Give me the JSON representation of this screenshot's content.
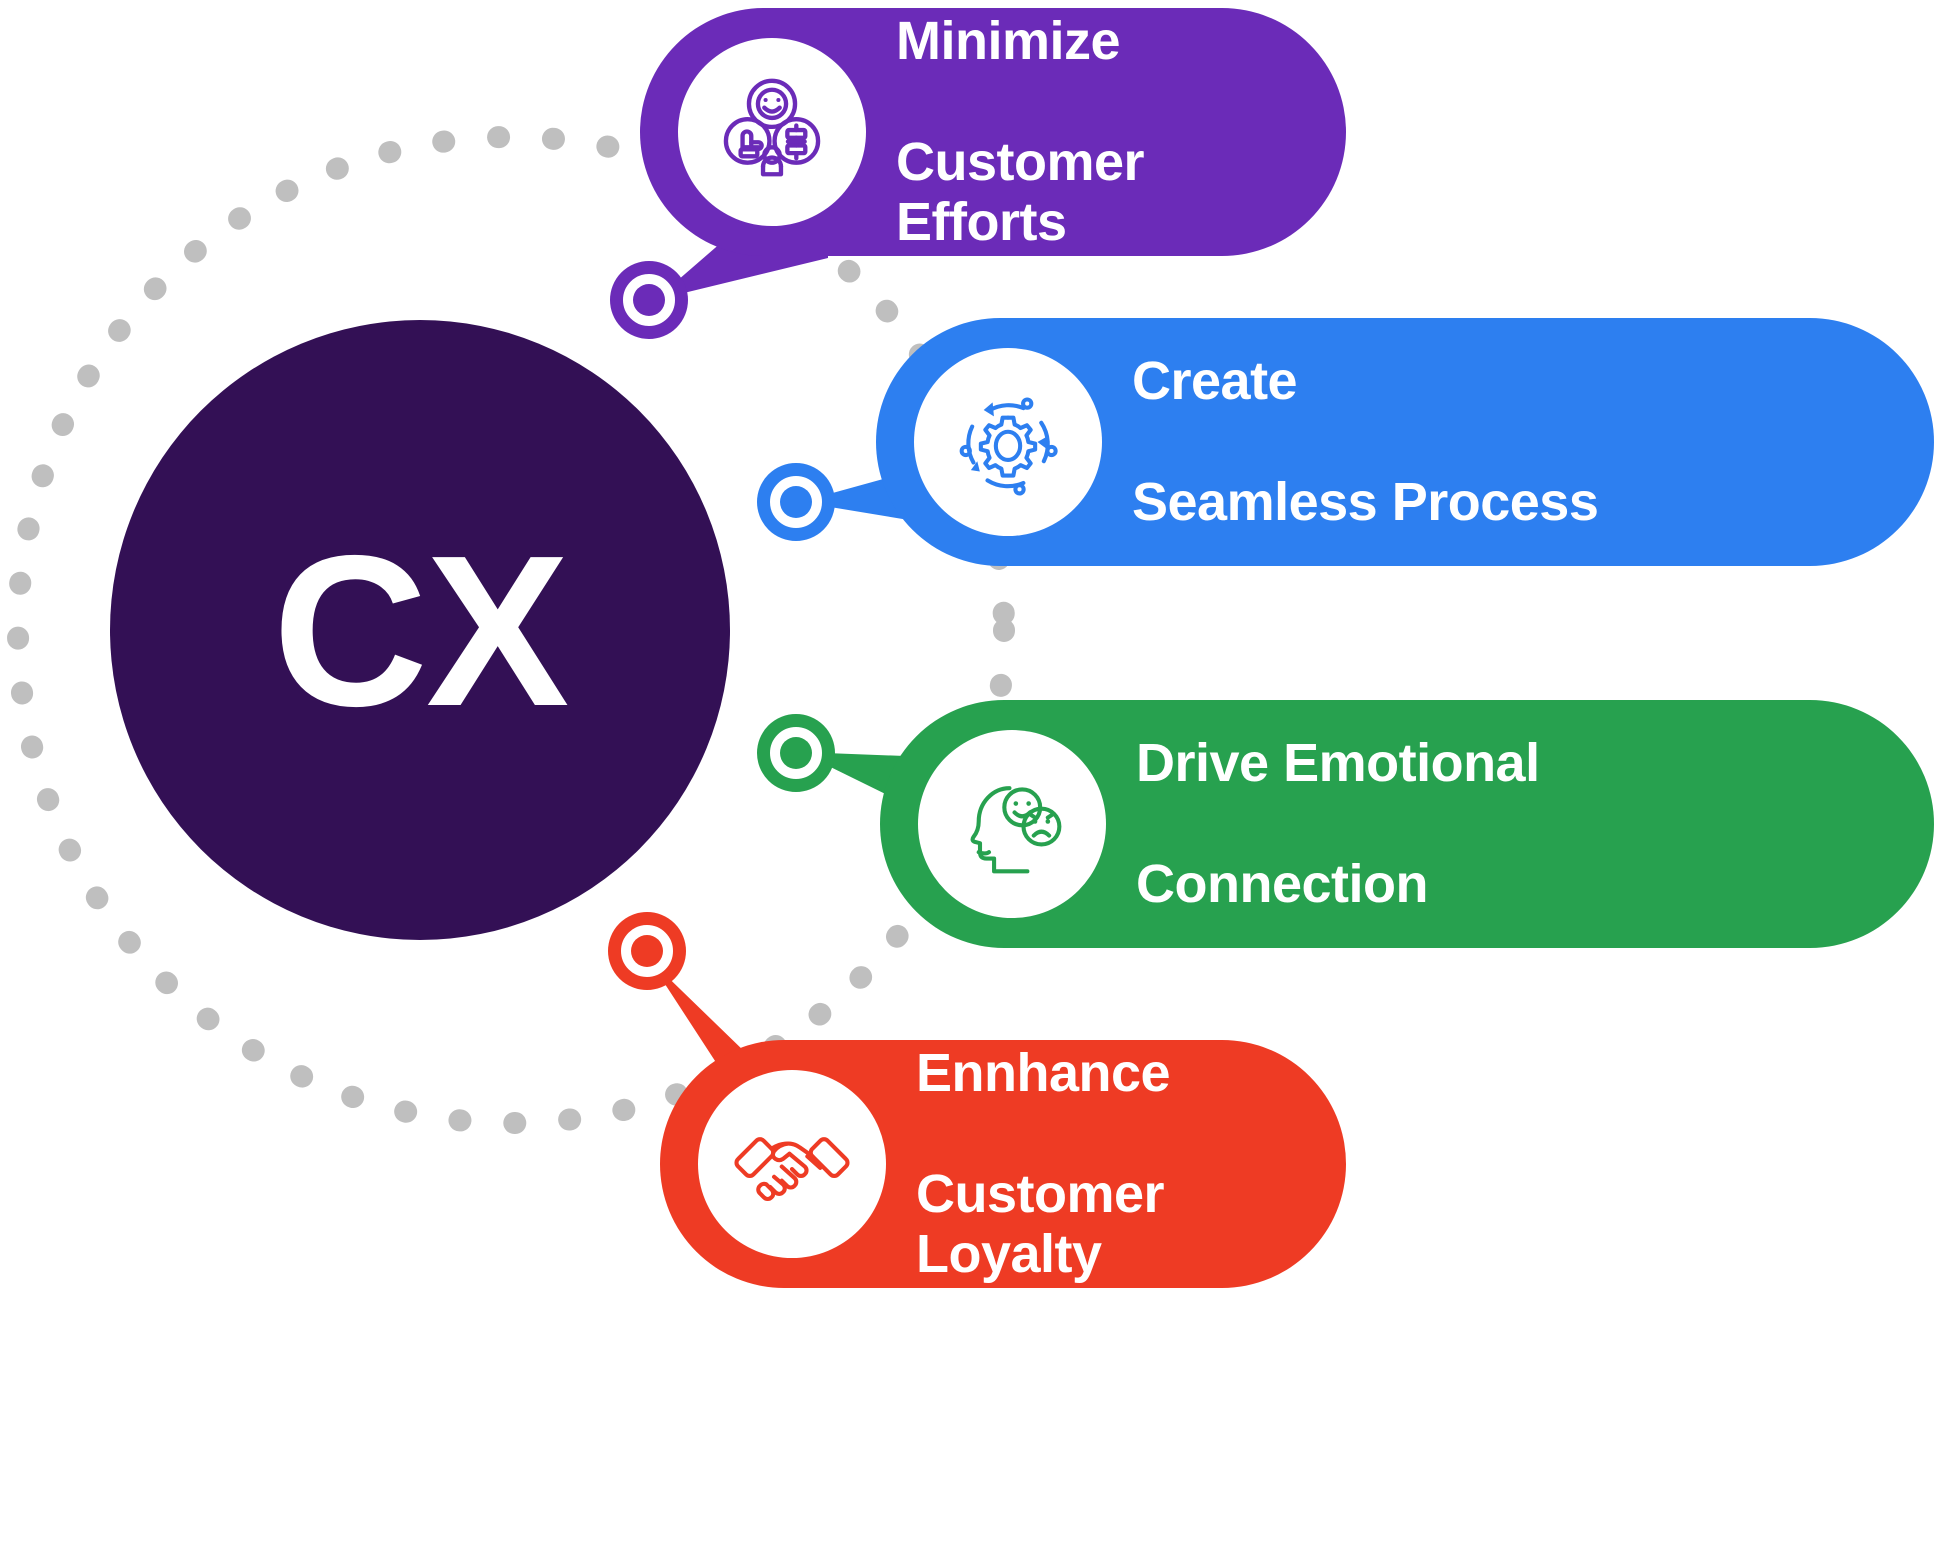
{
  "diagram": {
    "title": "CX",
    "hub": {
      "label": "CX",
      "color": "#331055"
    },
    "dotted_track": {
      "color": "#BFBFBF",
      "style": "dotted-circle"
    },
    "branches": [
      {
        "id": "minimize-customer-efforts",
        "line1": "Minimize",
        "line2": "Customer Efforts",
        "color": "#6B2BB8",
        "icon": "customer-feedback-group-icon",
        "node_color": "#6B2BB8"
      },
      {
        "id": "create-seamless-process",
        "line1": "Create",
        "line2": "Seamless Process",
        "color": "#2D7FF0",
        "icon": "gear-process-cycle-icon",
        "node_color": "#2D7FF0"
      },
      {
        "id": "drive-emotional-connection",
        "line1": "Drive Emotional",
        "line2": "Connection",
        "color": "#27A14F",
        "icon": "head-emotion-faces-icon",
        "node_color": "#27A14F"
      },
      {
        "id": "ennhance-customer-loyalty",
        "line1": "Ennhance",
        "line2": "Customer Loyalty",
        "color": "#EE3B24",
        "icon": "handshake-icon",
        "node_color": "#EE3B24"
      }
    ]
  }
}
